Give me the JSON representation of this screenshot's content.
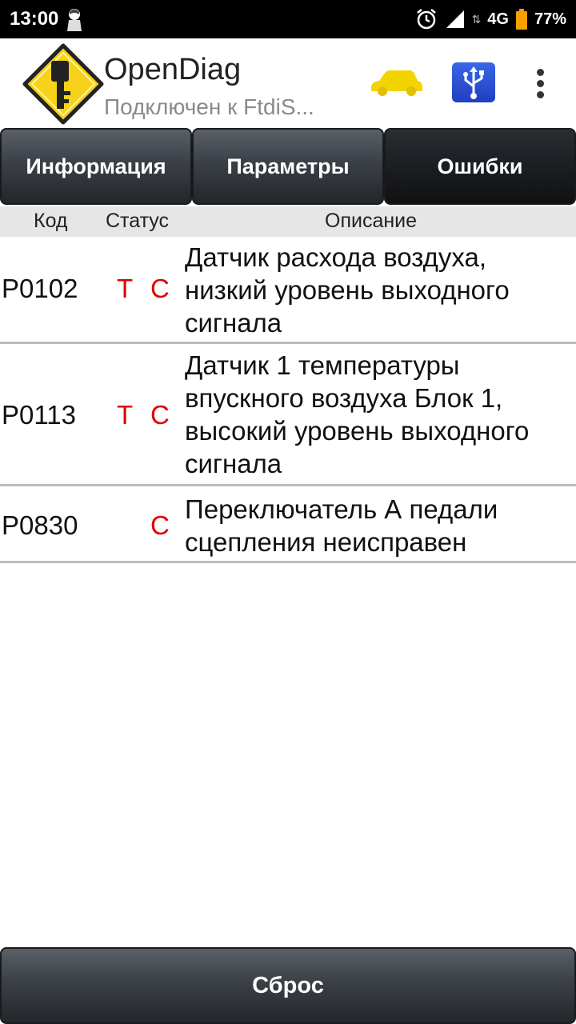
{
  "status_bar": {
    "time": "13:00",
    "network": "4G",
    "data_arrows": "⇅",
    "battery": "77%",
    "icons": [
      "notification-avatar-icon",
      "alarm-icon",
      "signal-icon",
      "battery-icon"
    ]
  },
  "app_bar": {
    "title": "OpenDiag",
    "subtitle": "Подключен к FtdiS...",
    "icons": [
      "opendiag-logo",
      "car-icon",
      "usb-icon",
      "overflow-menu-icon"
    ]
  },
  "tabs": [
    {
      "label": "Информация",
      "active": false
    },
    {
      "label": "Параметры",
      "active": false
    },
    {
      "label": "Ошибки",
      "active": true
    }
  ],
  "table": {
    "headers": {
      "code": "Код",
      "status": "Статус",
      "description": "Описание"
    },
    "rows": [
      {
        "code": "P0102",
        "status_t": "T",
        "status_c": "C",
        "description": "Датчик расхода воздуха, низкий уровень выходного сигнала"
      },
      {
        "code": "P0113",
        "status_t": "T",
        "status_c": "C",
        "description": "Датчик 1 температуры впускного воздуха Блок 1, высокий уровень выходного сигнала"
      },
      {
        "code": "P0830",
        "status_t": "",
        "status_c": "C",
        "description": "Переключатель А педали сцепления неисправен"
      }
    ]
  },
  "reset_button": {
    "label": "Сброс"
  },
  "colors": {
    "status_red": "#e00000",
    "car_yellow": "#f2d400",
    "usb_blue": "#2a4fd6"
  }
}
